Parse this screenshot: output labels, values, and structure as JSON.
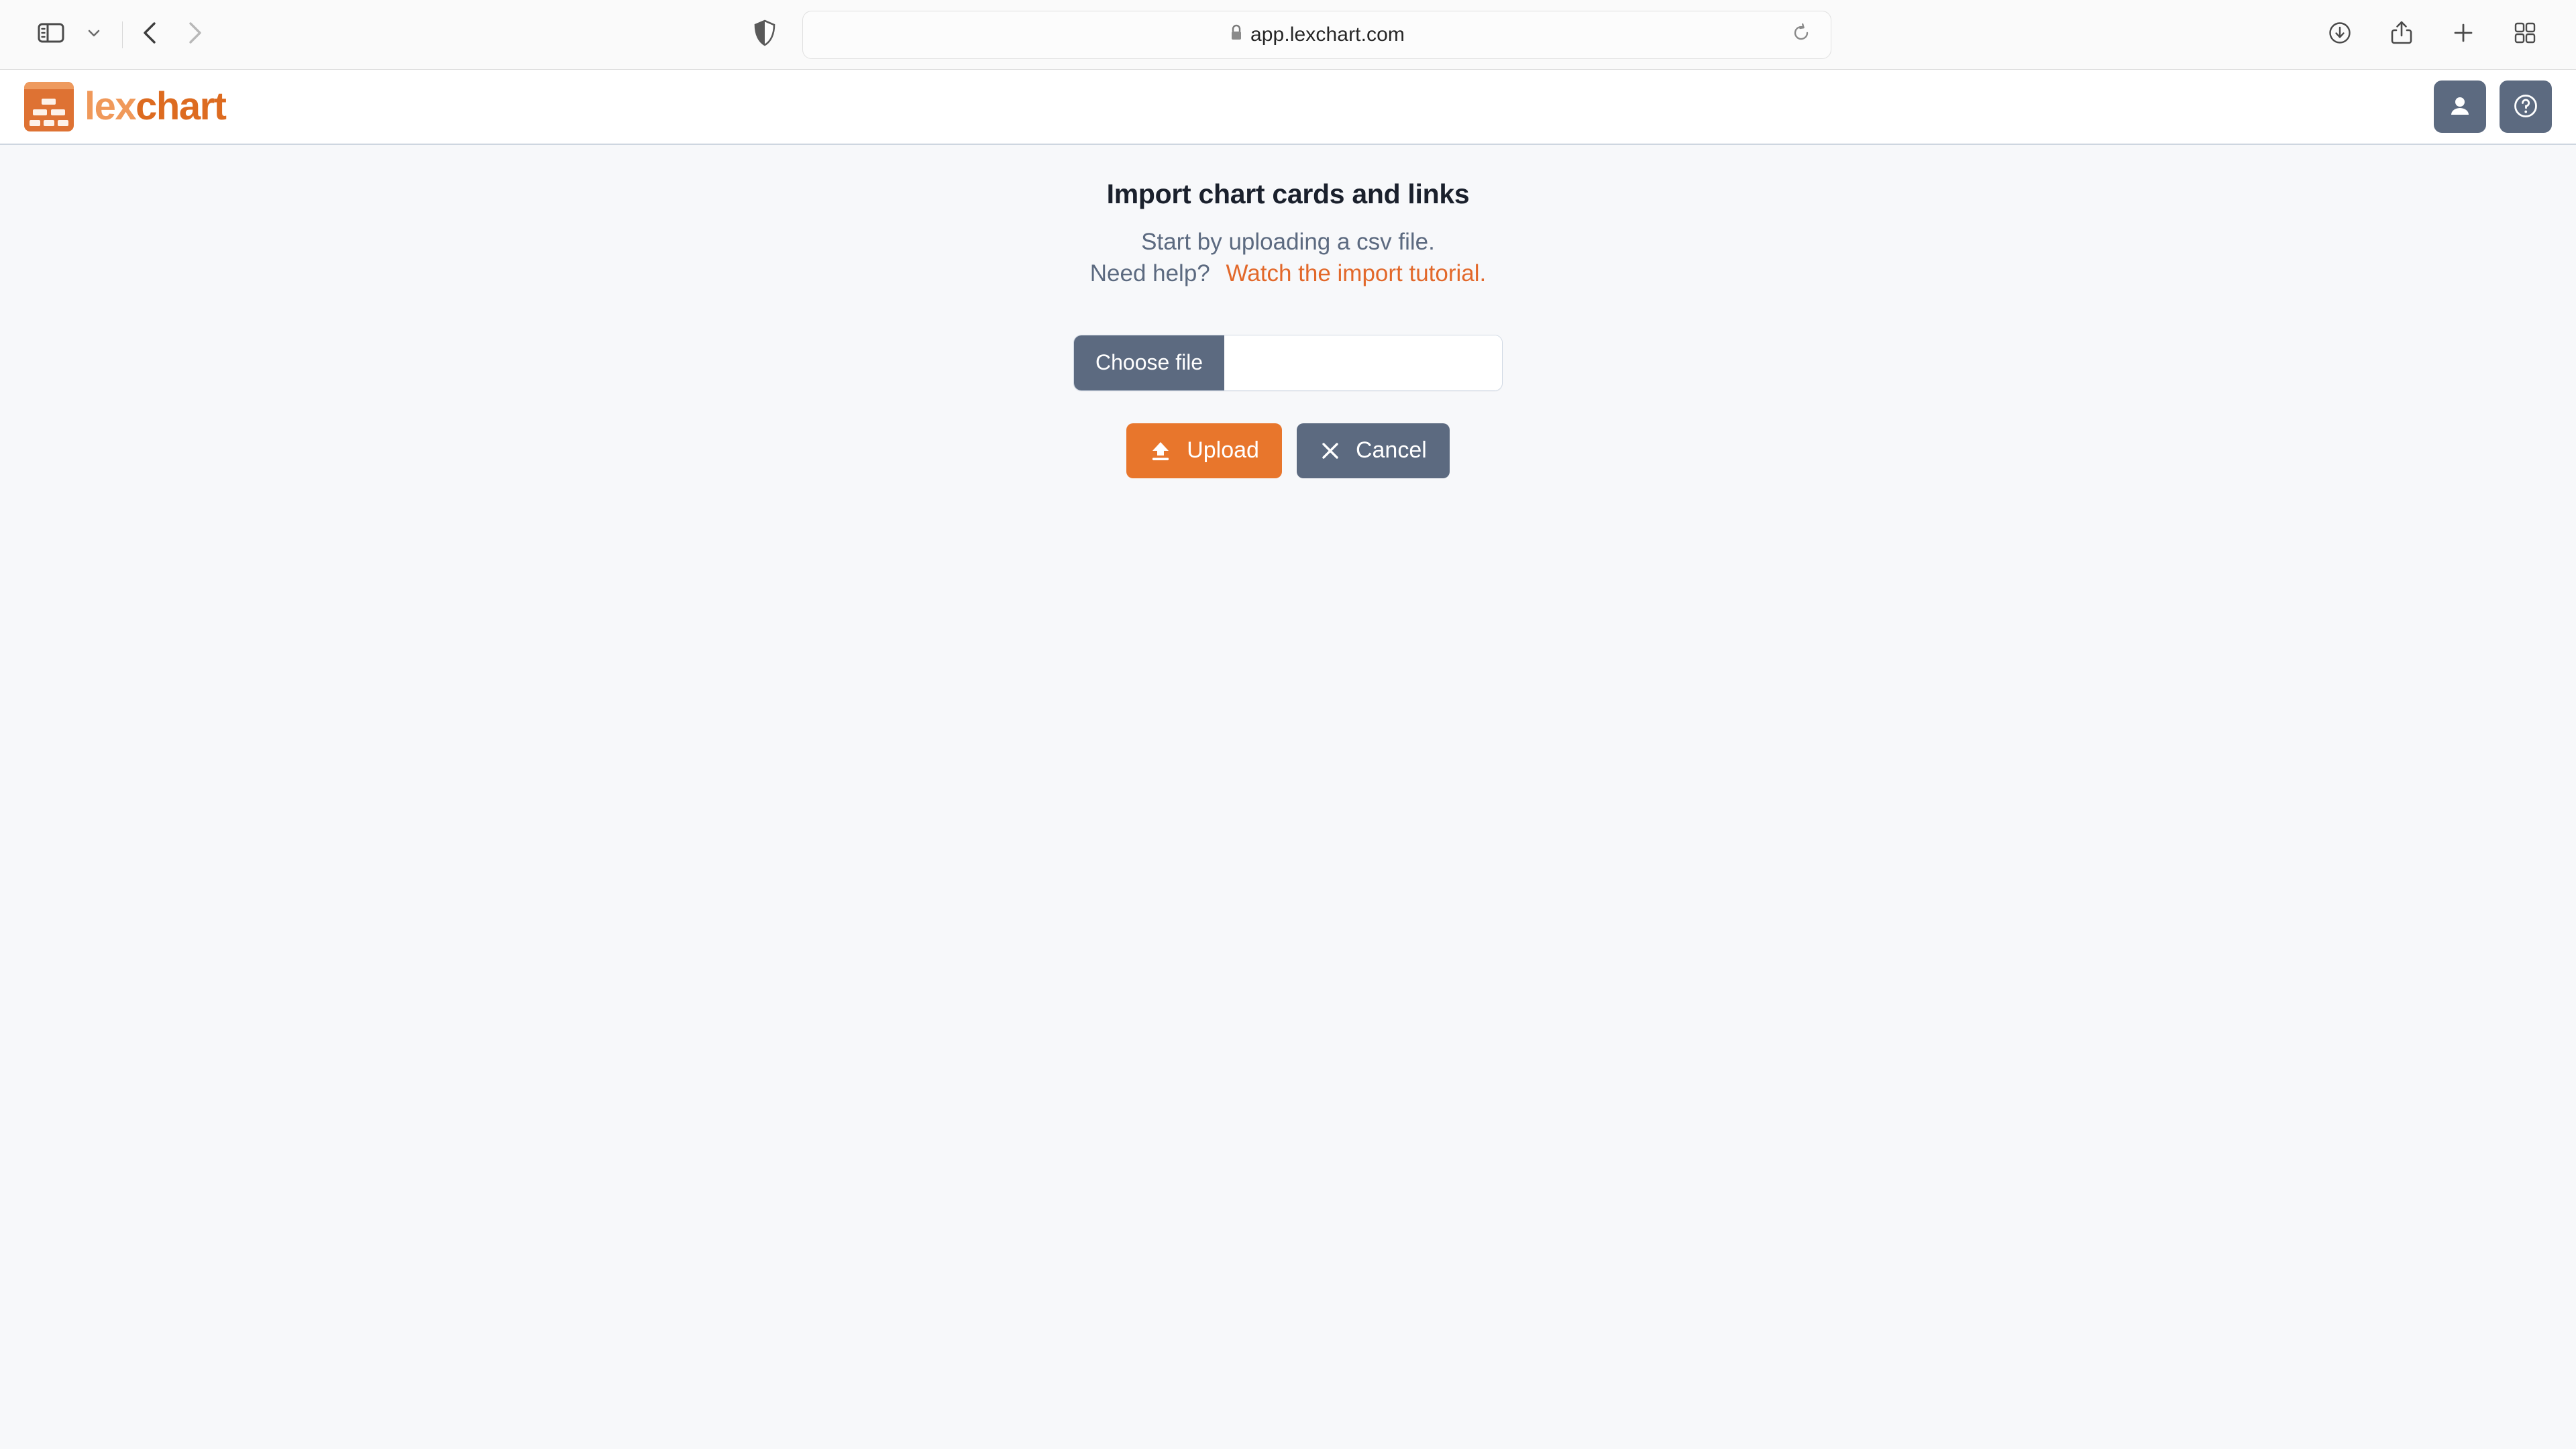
{
  "browser": {
    "name": "safari",
    "sidebar_toggle_icon": "sidebar-icon",
    "sidebar_dropdown_icon": "chevron-down-icon",
    "back_icon": "chevron-left-icon",
    "forward_icon": "chevron-right-icon",
    "privacy_icon": "shield-icon",
    "url": "app.lexchart.com",
    "url_lock_icon": "lock-icon",
    "reload_icon": "reload-icon",
    "toolbar_icons": [
      "downloads-icon",
      "share-icon",
      "new-tab-icon",
      "tab-overview-icon"
    ]
  },
  "app_header": {
    "logo_icon": "lexchart-logo-icon",
    "logo_text_primary": "lex",
    "logo_text_secondary": "chart",
    "account_button_icon": "user-icon",
    "help_button_icon": "help-circle-icon"
  },
  "main": {
    "title": "Import chart cards and links",
    "subtitle": "Start by uploading a csv file.",
    "help_prompt": "Need help?",
    "tutorial_link": "Watch the import tutorial.",
    "file_picker": {
      "button_label": "Choose file",
      "value": "",
      "placeholder": ""
    },
    "actions": {
      "upload_label": "Upload",
      "upload_icon": "upload-icon",
      "cancel_label": "Cancel",
      "cancel_icon": "close-icon"
    }
  },
  "colors": {
    "brand_orange": "#E8762C",
    "logo_light_orange": "#F0995A",
    "logo_dark_orange": "#DD6B20",
    "link_orange": "#E2682A",
    "slate": "#5C6A80",
    "page_bg": "#F7F8FA",
    "header_border": "#CED6E0",
    "title_text": "#1A202C"
  }
}
